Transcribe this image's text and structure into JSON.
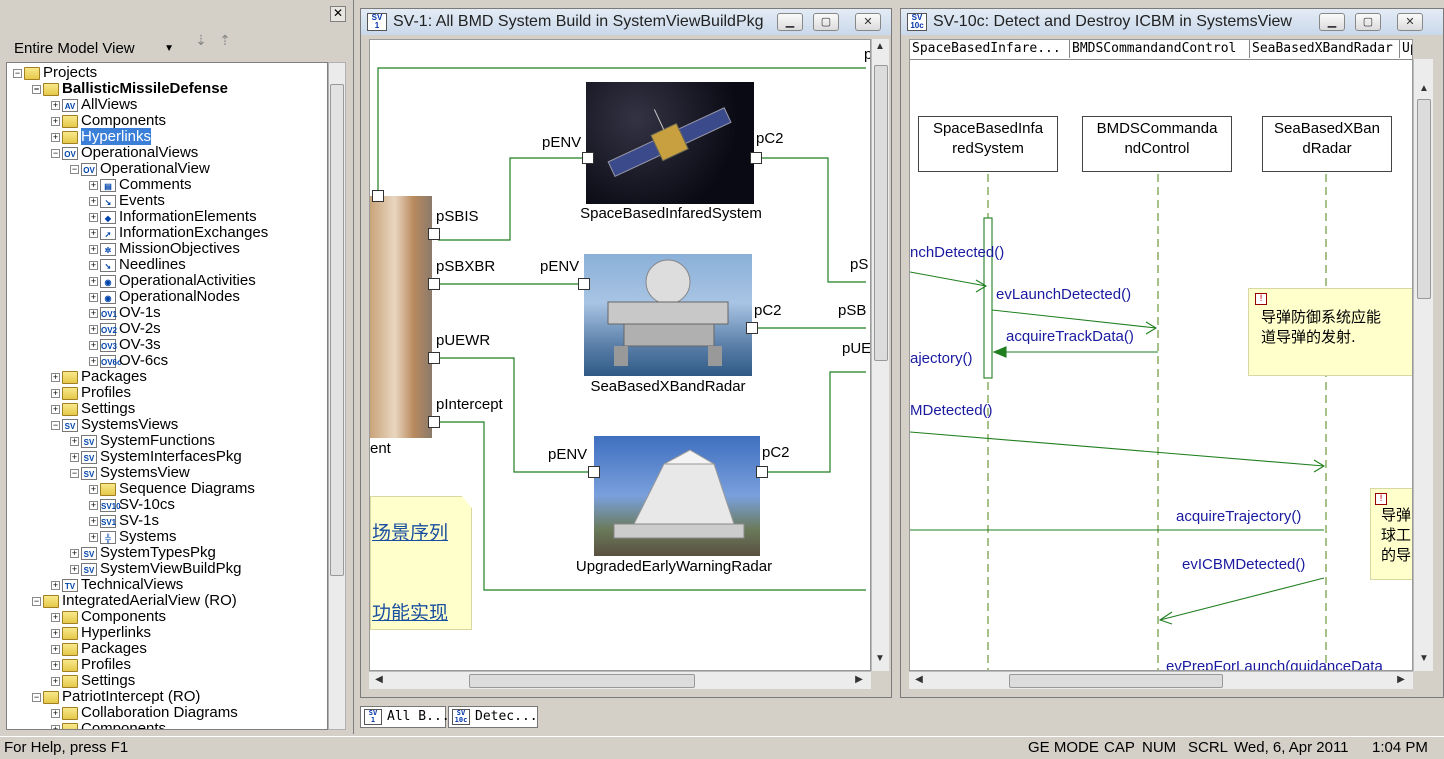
{
  "browser": {
    "view_select": "Entire Model View",
    "close_glyph": "✕",
    "tree": [
      {
        "label": "Projects",
        "icon": "folder-icon"
      },
      {
        "label": "BallisticMissileDefense",
        "icon": "project-icon"
      },
      {
        "label": "AllViews",
        "icon": "av-icon"
      },
      {
        "label": "Components",
        "icon": "folder-icon"
      },
      {
        "label": "Hyperlinks",
        "icon": "hyperlink-folder-icon"
      },
      {
        "label": "OperationalViews",
        "icon": "ov-icon"
      },
      {
        "label": "OperationalView",
        "icon": "ov-package-icon"
      },
      {
        "label": "Comments",
        "icon": "comment-icon"
      },
      {
        "label": "Events",
        "icon": "event-icon"
      },
      {
        "label": "InformationElements",
        "icon": "info-element-icon"
      },
      {
        "label": "InformationExchanges",
        "icon": "info-exchange-icon"
      },
      {
        "label": "MissionObjectives",
        "icon": "mission-objective-icon"
      },
      {
        "label": "Needlines",
        "icon": "needline-icon"
      },
      {
        "label": "OperationalActivities",
        "icon": "eye-icon"
      },
      {
        "label": "OperationalNodes",
        "icon": "eye-icon"
      },
      {
        "label": "OV-1s",
        "icon": "ov1-icon"
      },
      {
        "label": "OV-2s",
        "icon": "ov2-icon"
      },
      {
        "label": "OV-3s",
        "icon": "ov3-icon"
      },
      {
        "label": "OV-6cs",
        "icon": "ov6c-icon"
      },
      {
        "label": "Packages",
        "icon": "folder-icon"
      },
      {
        "label": "Profiles",
        "icon": "folder-icon"
      },
      {
        "label": "Settings",
        "icon": "folder-icon"
      },
      {
        "label": "SystemsViews",
        "icon": "sv-icon"
      },
      {
        "label": "SystemFunctions",
        "icon": "sv-package-icon"
      },
      {
        "label": "SystemInterfacesPkg",
        "icon": "sv-package-icon"
      },
      {
        "label": "SystemsView",
        "icon": "sv-package-icon"
      },
      {
        "label": "Sequence Diagrams",
        "icon": "folder-icon"
      },
      {
        "label": "SV-10cs",
        "icon": "sv10c-icon"
      },
      {
        "label": "SV-1s",
        "icon": "sv1-icon"
      },
      {
        "label": "Systems",
        "icon": "systems-icon"
      },
      {
        "label": "SystemTypesPkg",
        "icon": "sv-package-icon"
      },
      {
        "label": "SystemViewBuildPkg",
        "icon": "sv-package-icon"
      },
      {
        "label": "TechnicalViews",
        "icon": "tv-icon"
      },
      {
        "label": "IntegratedAerialView (RO)",
        "icon": "project-icon"
      },
      {
        "label": "Components",
        "icon": "folder-icon"
      },
      {
        "label": "Hyperlinks",
        "icon": "hyperlink-folder-icon"
      },
      {
        "label": "Packages",
        "icon": "folder-icon"
      },
      {
        "label": "Profiles",
        "icon": "folder-icon"
      },
      {
        "label": "Settings",
        "icon": "folder-icon"
      },
      {
        "label": "PatriotIntercept (RO)",
        "icon": "project-icon"
      },
      {
        "label": "Collaboration Diagrams",
        "icon": "folder-icon"
      },
      {
        "label": "Components",
        "icon": "folder-icon"
      }
    ]
  },
  "sv1": {
    "title": "SV-1: All BMD System Build in SystemViewBuildPkg",
    "icon_text": "SV\n1",
    "left_block_label": "ent",
    "top_port": "p",
    "ports": {
      "pSBIS": "pSBIS",
      "pSBXBR": "pSBXBR",
      "pUEWR": "pUEWR",
      "pIntercept": "pIntercept",
      "sbis_env": "pENV",
      "sbis_c2": "pC2",
      "sbx_env": "pENV",
      "sbx_c2": "pC2",
      "uewr_env": "pENV",
      "uewr_c2": "pC2",
      "right_s": "pS",
      "right_sb": "pSB",
      "right_ue": "pUE"
    },
    "blocks": [
      "SpaceBasedInfaredSystem",
      "SeaBasedXBandRadar",
      "UpgradedEarlyWarningRadar"
    ],
    "note_links": [
      "场景序列",
      "功能实现"
    ]
  },
  "sv10c": {
    "title": "SV-10c: Detect and Destroy ICBM in SystemsView",
    "icon_text": "SV\n10c",
    "header_cols": [
      "SpaceBasedInfare...",
      "BMDSCommandandControl",
      "SeaBasedXBandRadar",
      "Upgr"
    ],
    "lifelines": [
      [
        "SpaceBasedInfa",
        "redSystem"
      ],
      [
        "BMDSCommanda",
        "ndControl"
      ],
      [
        "SeaBasedXBan",
        "dRadar"
      ]
    ],
    "messages": [
      "nchDetected()",
      "evLaunchDetected()",
      "acquireTrackData()",
      "ajectory()",
      "MDetected()",
      "acquireTrajectory()",
      "evICBMDetected()",
      "evPrepForLaunch(guidanceData"
    ],
    "note1": [
      "导弹防御系统应能",
      "道导弹的发射."
    ],
    "note2": [
      "导弹",
      "球工",
      "的导"
    ]
  },
  "tabs": [
    {
      "label": "All B...",
      "icon": "SV\n1"
    },
    {
      "label": "Detec...",
      "icon": "SV\n10c"
    }
  ],
  "status": {
    "help": "For Help, press F1",
    "mode": "GE MODE",
    "cap": "CAP",
    "num": "NUM",
    "scrl": "SCRL",
    "date": "Wed, 6, Apr 2011",
    "time": "1:04  PM"
  }
}
